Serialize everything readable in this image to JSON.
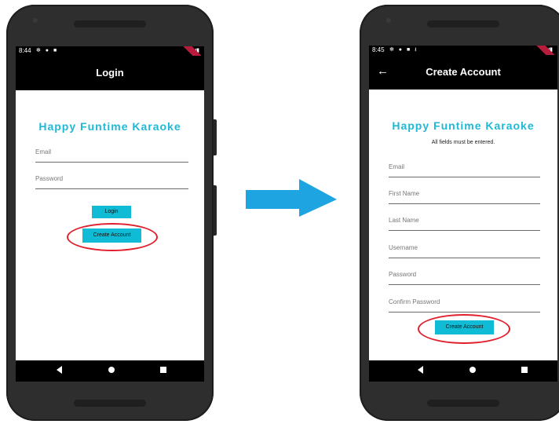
{
  "left_phone": {
    "status": {
      "time": "8:44"
    },
    "appbar": {
      "title": "Login"
    },
    "brand": "Happy Funtime Karaoke",
    "fields": [
      {
        "placeholder": "Email"
      },
      {
        "placeholder": "Password"
      }
    ],
    "login_button": "Login",
    "create_account_button": "Create Account"
  },
  "right_phone": {
    "status": {
      "time": "8:45"
    },
    "appbar": {
      "title": "Create Account"
    },
    "brand": "Happy Funtime Karaoke",
    "note": "All fields must be entered.",
    "fields": [
      {
        "placeholder": "Email"
      },
      {
        "placeholder": "First Name"
      },
      {
        "placeholder": "Last Name"
      },
      {
        "placeholder": "Username"
      },
      {
        "placeholder": "Password"
      },
      {
        "placeholder": "Confirm Password"
      }
    ],
    "create_account_button": "Create Account"
  },
  "colors": {
    "accent": "#1eb9d6",
    "button": "#10bcd5",
    "highlight": "#e0202c",
    "arrow": "#1ea4e0"
  }
}
